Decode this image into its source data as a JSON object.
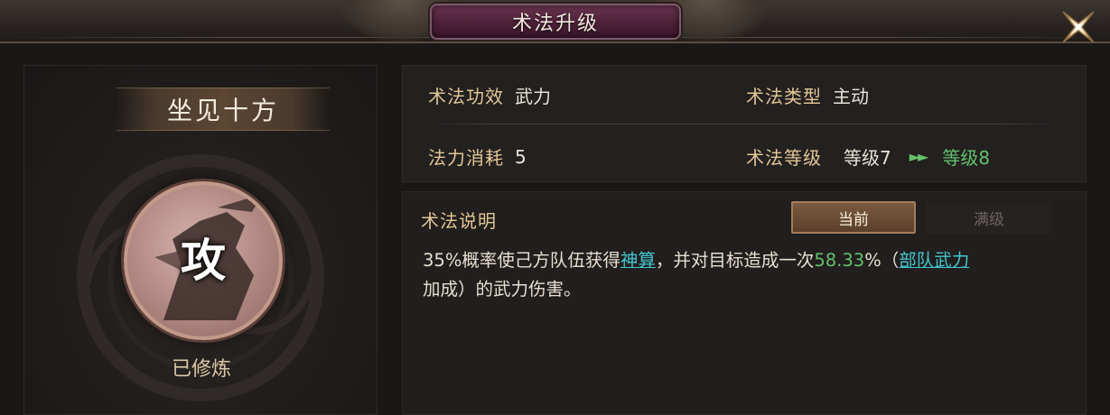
{
  "window": {
    "title": "术法升级"
  },
  "icons": {
    "close": "close-icon"
  },
  "skill": {
    "name": "坐见十方",
    "icon_char": "攻",
    "status": "已修炼"
  },
  "info": {
    "effect_label": "术法功效",
    "effect_value": "武力",
    "type_label": "术法类型",
    "type_value": "主动",
    "cost_label": "法力消耗",
    "cost_value": "5",
    "level_label": "术法等级",
    "level_current": "等级7",
    "level_arrow": "►►",
    "level_next": "等级8"
  },
  "description": {
    "title": "术法说明",
    "tabs": [
      "当前",
      "满级"
    ],
    "active_tab": "当前",
    "text_1": "35%概率使己方队伍获得",
    "keyword_1": "神算",
    "text_2": "，并对目标造成一次",
    "value_1": "58.33",
    "text_3": "%（",
    "keyword_2": "部队武力",
    "text_4": "加成）的武力伤害。"
  },
  "colors": {
    "label_gold": "#e2c795",
    "upgrade_green": "#62c26a",
    "keyword_cyan": "#41c6cf",
    "title_plate": "#4d2038"
  }
}
